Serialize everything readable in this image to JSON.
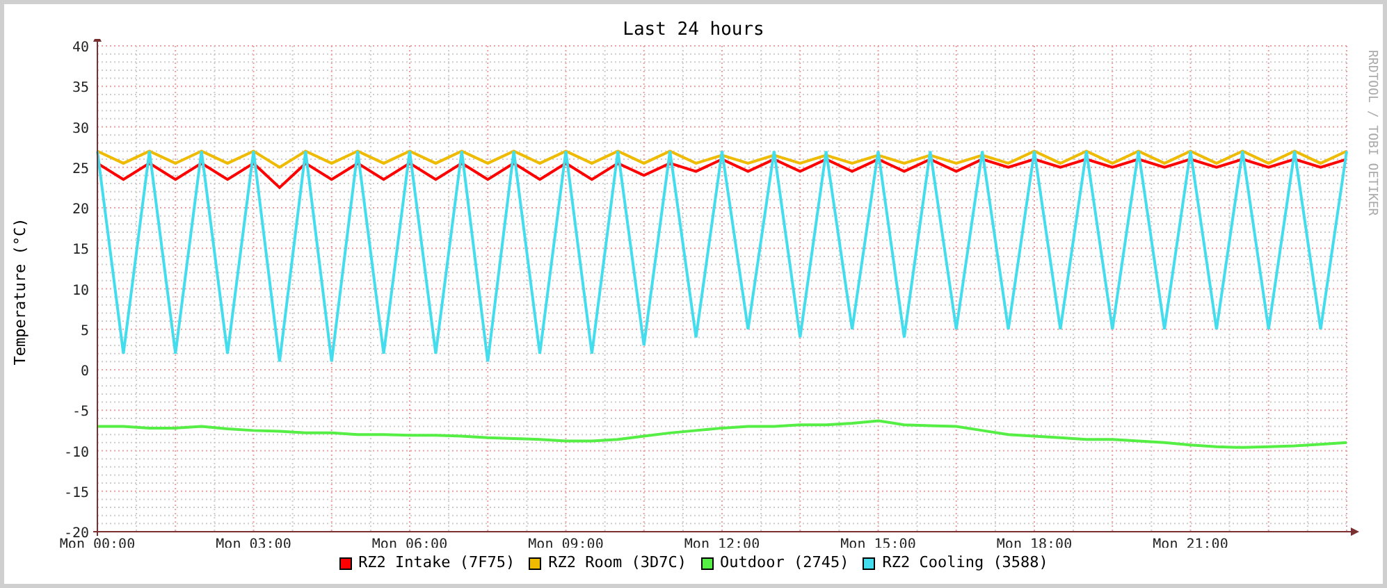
{
  "title": "Last 24 hours",
  "credit": "RRDTOOL / TOBI OETIKER",
  "chart_data": {
    "type": "line",
    "ylabel": "Temperature (°C)",
    "categories": [
      "Mon 00:00",
      null,
      null,
      null,
      null,
      null,
      "Mon 03:00",
      null,
      null,
      null,
      null,
      null,
      "Mon 06:00",
      null,
      null,
      null,
      null,
      null,
      "Mon 09:00",
      null,
      null,
      null,
      null,
      null,
      "Mon 12:00",
      null,
      null,
      null,
      null,
      null,
      "Mon 15:00",
      null,
      null,
      null,
      null,
      null,
      "Mon 18:00",
      null,
      null,
      null,
      null,
      null,
      "Mon 21:00",
      null,
      null,
      null,
      null,
      null,
      null
    ],
    "ylim": [
      -20,
      40
    ],
    "grid": true,
    "yticks": [
      -20,
      -15,
      -10,
      -5,
      0,
      5,
      10,
      15,
      20,
      25,
      30,
      35,
      40
    ],
    "series": [
      {
        "name": "RZ2 Intake (7F75)",
        "color": "#ff0000",
        "values": [
          25.5,
          23.5,
          25.5,
          23.5,
          25.5,
          23.5,
          25.5,
          22.5,
          25.5,
          23.5,
          25.5,
          23.5,
          25.5,
          23.5,
          25.5,
          23.5,
          25.5,
          23.5,
          25.5,
          23.5,
          25.5,
          24,
          25.5,
          24.5,
          26,
          24.5,
          26,
          24.5,
          26,
          24.5,
          26,
          24.5,
          26,
          24.5,
          26,
          25,
          26,
          25,
          26,
          25,
          26,
          25,
          26,
          25,
          26,
          25,
          26,
          25,
          26
        ]
      },
      {
        "name": "RZ2 Room (3D7C)",
        "color": "#eebb00",
        "values": [
          27,
          25.5,
          27,
          25.5,
          27,
          25.5,
          27,
          25,
          27,
          25.5,
          27,
          25.5,
          27,
          25.5,
          27,
          25.5,
          27,
          25.5,
          27,
          25.5,
          27,
          25.5,
          27,
          25.5,
          26.5,
          25.5,
          26.5,
          25.5,
          26.5,
          25.5,
          26.5,
          25.5,
          26.5,
          25.5,
          26.5,
          25.5,
          27,
          25.5,
          27,
          25.5,
          27,
          25.5,
          27,
          25.5,
          27,
          25.5,
          27,
          25.5,
          27
        ]
      },
      {
        "name": "Outdoor (2745)",
        "color": "#55ee44",
        "values": [
          -7,
          -7,
          -7.2,
          -7.2,
          -7,
          -7.3,
          -7.5,
          -7.6,
          -7.8,
          -7.8,
          -8,
          -8,
          -8.1,
          -8.1,
          -8.2,
          -8.4,
          -8.5,
          -8.6,
          -8.8,
          -8.8,
          -8.6,
          -8.2,
          -7.8,
          -7.5,
          -7.2,
          -7,
          -7,
          -6.8,
          -6.8,
          -6.6,
          -6.3,
          -6.8,
          -6.9,
          -7,
          -7.5,
          -8,
          -8.2,
          -8.4,
          -8.6,
          -8.6,
          -8.8,
          -9,
          -9.3,
          -9.5,
          -9.6,
          -9.5,
          -9.4,
          -9.2,
          -9
        ]
      },
      {
        "name": "RZ2 Cooling (3588)",
        "color": "#44ddee",
        "values": [
          27,
          2,
          27,
          2,
          27,
          2,
          27,
          1,
          27,
          1,
          27,
          2,
          27,
          2,
          27,
          1,
          27,
          2,
          27,
          2,
          27,
          3,
          27,
          4,
          27,
          5,
          27,
          4,
          27,
          5,
          27,
          4,
          27,
          5,
          27,
          5,
          27,
          5,
          27,
          5,
          27,
          5,
          27,
          5,
          27,
          5,
          27,
          5,
          27
        ]
      }
    ]
  }
}
